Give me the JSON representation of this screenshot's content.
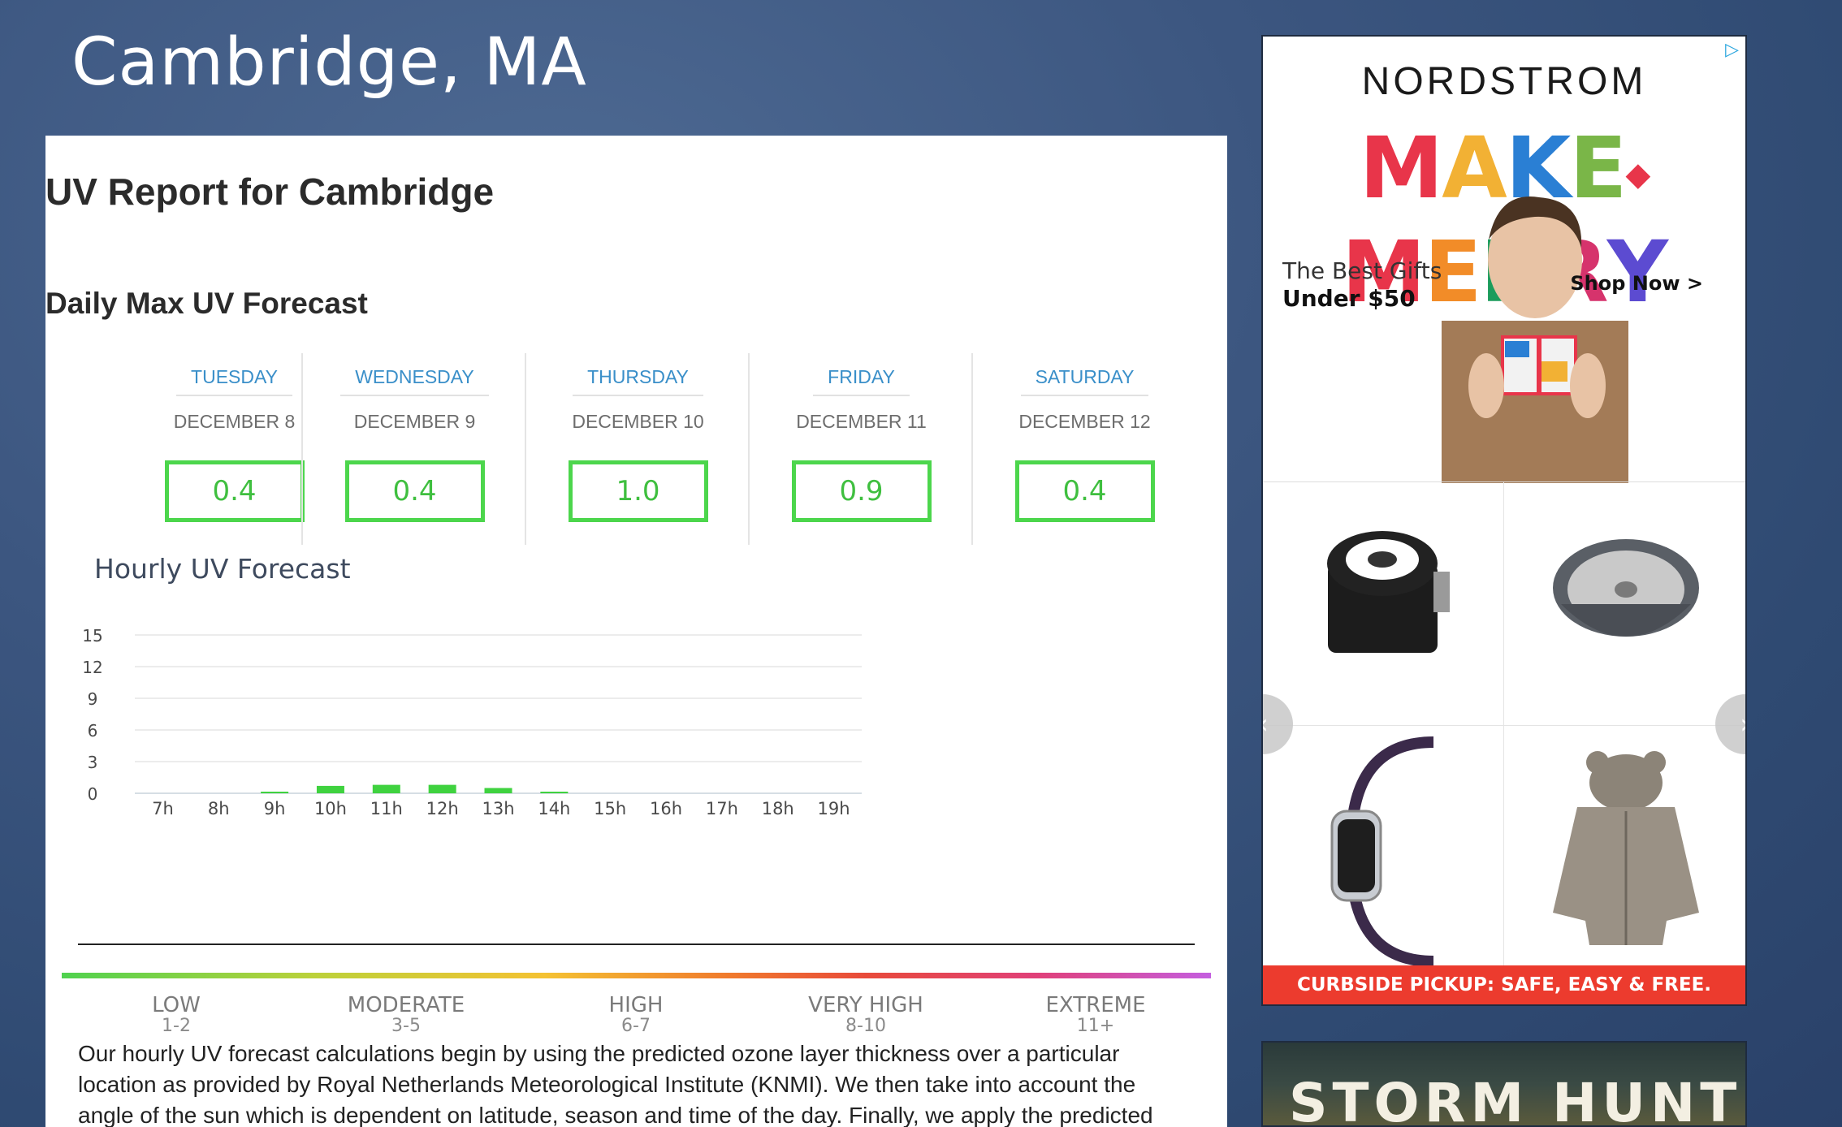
{
  "city": "Cambridge, MA",
  "report": {
    "title": "UV Report for Cambridge",
    "daily_heading": "Daily Max UV Forecast",
    "days": [
      {
        "weekday": "TUESDAY",
        "date": "DECEMBER 8",
        "uv": "0.4"
      },
      {
        "weekday": "WEDNESDAY",
        "date": "DECEMBER 9",
        "uv": "0.4"
      },
      {
        "weekday": "THURSDAY",
        "date": "DECEMBER 10",
        "uv": "1.0"
      },
      {
        "weekday": "FRIDAY",
        "date": "DECEMBER 11",
        "uv": "0.9"
      },
      {
        "weekday": "SATURDAY",
        "date": "DECEMBER 12",
        "uv": "0.4"
      }
    ],
    "hourly_heading": "Hourly UV Forecast",
    "scale": [
      {
        "label": "LOW",
        "range": "1-2"
      },
      {
        "label": "MODERATE",
        "range": "3-5"
      },
      {
        "label": "HIGH",
        "range": "6-7"
      },
      {
        "label": "VERY HIGH",
        "range": "8-10"
      },
      {
        "label": "EXTREME",
        "range": "11+"
      }
    ],
    "description": "Our hourly UV forecast calculations begin by using the predicted ozone layer thickness over a particular location as provided by Royal Netherlands Meteorological Institute (KNMI). We then take into account the angle of the sun which is dependent on latitude, season and time of the day. Finally, we apply the predicted"
  },
  "chart_data": {
    "type": "bar",
    "categories": [
      "7h",
      "8h",
      "9h",
      "10h",
      "11h",
      "12h",
      "13h",
      "14h",
      "15h",
      "16h",
      "17h",
      "18h",
      "19h"
    ],
    "values": [
      0,
      0,
      0.1,
      0.7,
      0.8,
      0.8,
      0.5,
      0.1,
      0,
      0,
      0,
      0,
      0
    ],
    "yticks": [
      "0",
      "3",
      "6",
      "9",
      "12",
      "15"
    ],
    "ylim": [
      0,
      15
    ],
    "bar_color": "#3fd23f",
    "grid": true
  },
  "ad": {
    "ad_choice_icon": "adchoices-icon",
    "brand": "NORDSTROM",
    "headline": [
      "MAKE",
      "◆",
      "MERRY"
    ],
    "headline_colors": [
      "#e8354a",
      "#f2b134",
      "#2a7fd4",
      "#7ab648",
      "#e8354a",
      "#f28c28",
      "#1c9c5c",
      "#d6336c",
      "#5c4bd1",
      "#e8354a",
      "#2a9fd6"
    ],
    "tagline_line1": "The Best Gifts",
    "tagline_line2": "Under $50",
    "shop_now": "Shop Now >",
    "pickup": "CURBSIDE PICKUP: SAFE, EASY & FREE.",
    "products": [
      "coffee-canister",
      "bundt-pan",
      "smartwatch",
      "faux-fur-jacket"
    ],
    "prev": "‹",
    "next": "›"
  },
  "ad2": {
    "title": "STORM HUNTERS"
  }
}
